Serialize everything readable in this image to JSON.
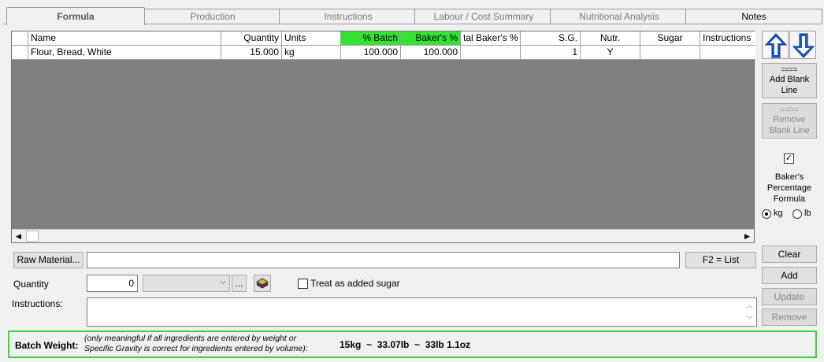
{
  "tabs": [
    {
      "label": "Formula"
    },
    {
      "label": "Production"
    },
    {
      "label": "Instructions"
    },
    {
      "label": "Labour / Cost Summary"
    },
    {
      "label": "Nutritional Analysis"
    },
    {
      "label": "Notes"
    }
  ],
  "grid": {
    "columns": [
      "",
      "Name",
      "Quantity",
      "Units",
      "% Batch",
      "Baker's %",
      "tal Baker's %",
      "S.G.",
      "Nutr.",
      "Sugar",
      "Instructions"
    ],
    "rows": [
      {
        "name": "Flour, Bread, White",
        "quantity": "15.000",
        "units": "kg",
        "pct_batch": "100.000",
        "bakers_pct": "100.000",
        "total_bakers_pct": "",
        "sg": "1",
        "nutr": "Y",
        "sugar": "",
        "instructions": ""
      }
    ]
  },
  "sidebar": {
    "add_blank": {
      "line1": "====",
      "line2": "Add Blank",
      "line3": "Line"
    },
    "remove_blank": {
      "line1": "==/==",
      "line2": "Remove",
      "line3": "Blank Line"
    },
    "bakers_checkbox_mark": "☑",
    "bakers_label_1": "Baker's",
    "bakers_label_2": "Percentage",
    "bakers_label_3": "Formula",
    "unit_kg": "kg",
    "unit_lb": "lb"
  },
  "entry": {
    "raw_material_button": "Raw Material...",
    "raw_material_value": "",
    "f2_list_button": "F2 = List",
    "quantity_label": "Quantity",
    "quantity_value": "0",
    "ellipsis_button": "...",
    "sugar_checkbox_label": "Treat as added sugar",
    "instructions_label": "Instructions:"
  },
  "actions": {
    "clear": "Clear",
    "add": "Add",
    "update": "Update",
    "remove": "Remove"
  },
  "batch": {
    "label": "Batch Weight:",
    "note_line1": "(only meaningful if all ingredients are entered by weight or",
    "note_line2": "Specific Gravity is correct for ingredients entered by volume):",
    "value": "15kg  ~  33.07lb  ~  33lb 1.1oz"
  },
  "colors": {
    "highlight_green": "#33e233",
    "border_green": "#3bd13b",
    "grid_bg": "#808080",
    "arrow_blue": "#1e5fc9"
  }
}
